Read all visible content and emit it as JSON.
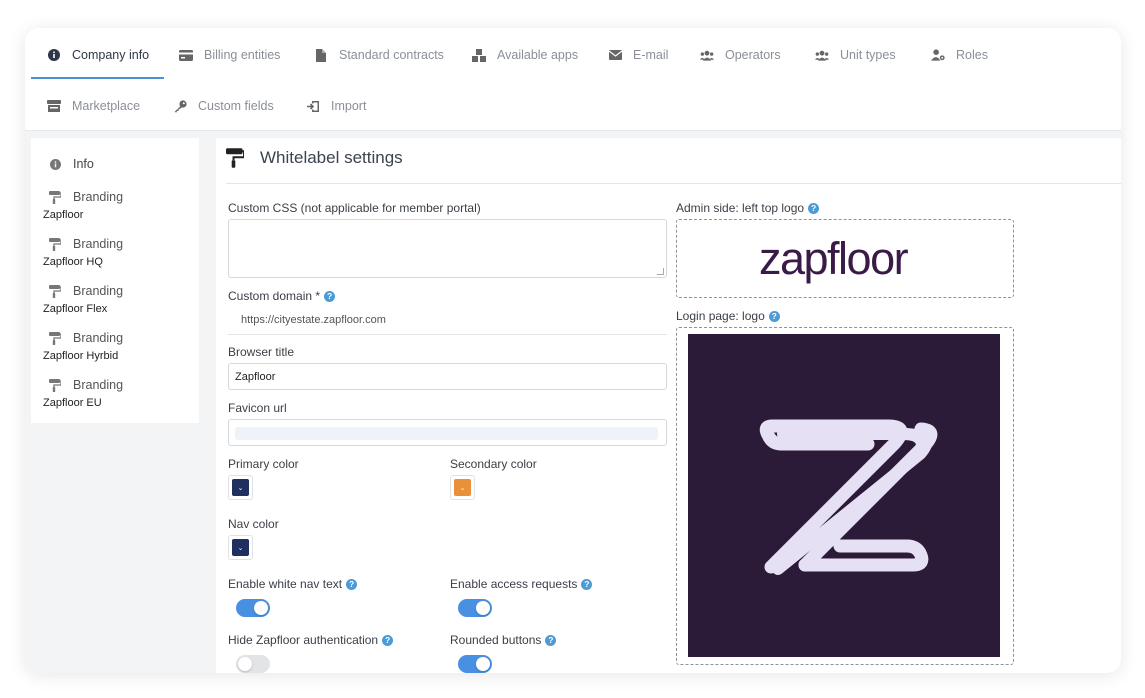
{
  "tabs": [
    {
      "label": "Company info",
      "icon": "info-circle-icon",
      "active": true
    },
    {
      "label": "Billing entities",
      "icon": "credit-card-icon"
    },
    {
      "label": "Standard contracts",
      "icon": "file-icon"
    },
    {
      "label": "Available apps",
      "icon": "cubes-icon"
    },
    {
      "label": "E-mail",
      "icon": "envelope-icon"
    },
    {
      "label": "Operators",
      "icon": "users-icon"
    },
    {
      "label": "Unit types",
      "icon": "users-icon"
    },
    {
      "label": "Roles",
      "icon": "user-cog-icon"
    },
    {
      "label": "Marketplace",
      "icon": "store-icon"
    },
    {
      "label": "Custom fields",
      "icon": "key-icon"
    },
    {
      "label": "Import",
      "icon": "import-icon"
    }
  ],
  "sidebar": {
    "info_label": "Info",
    "items": [
      {
        "label": "Branding",
        "sub": "Zapfloor"
      },
      {
        "label": "Branding",
        "sub": "Zapfloor HQ"
      },
      {
        "label": "Branding",
        "sub": "Zapfloor Flex"
      },
      {
        "label": "Branding",
        "sub": "Zapfloor Hyrbid"
      },
      {
        "label": "Branding",
        "sub": "Zapfloor EU"
      }
    ]
  },
  "panel": {
    "title": "Whitelabel settings",
    "custom_css_label": "Custom CSS (not applicable for member portal)",
    "custom_css_value": "",
    "custom_domain_label": "Custom domain *",
    "custom_domain_value": "https://cityestate.zapfloor.com",
    "browser_title_label": "Browser title",
    "browser_title_value": "Zapfloor",
    "favicon_label": "Favicon url",
    "favicon_value": "",
    "primary_color_label": "Primary color",
    "secondary_color_label": "Secondary color",
    "nav_color_label": "Nav color",
    "white_nav_text_label": "Enable white nav text",
    "access_requests_label": "Enable access requests",
    "hide_auth_label": "Hide Zapfloor authentication",
    "rounded_buttons_label": "Rounded buttons",
    "admin_logo_label": "Admin side: left top logo",
    "login_logo_label": "Login page: logo",
    "wordmark": "zapfloor"
  },
  "colors": {
    "primary": "#1f2f5e",
    "secondary": "#e8913a",
    "nav": "#1f2f5e",
    "accent": "#4a90e2",
    "login_bg": "#2c1a39",
    "logo_mark": "#e6e0f5"
  },
  "toggles": {
    "white_nav_text": true,
    "access_requests": true,
    "hide_auth": false,
    "rounded_buttons": true
  }
}
